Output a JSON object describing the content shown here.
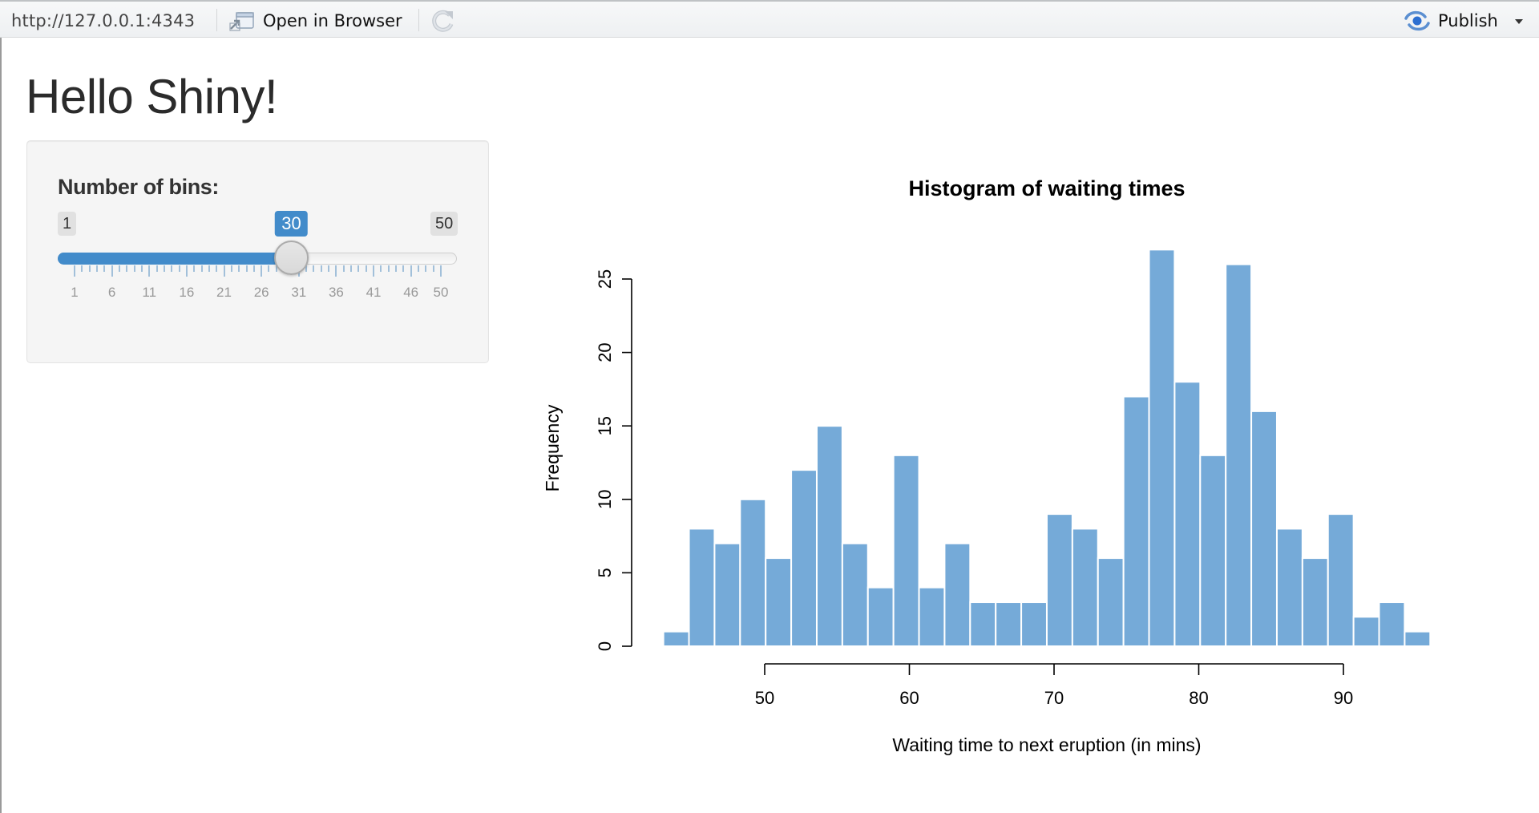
{
  "toolbar": {
    "url": "http://127.0.0.1:4343",
    "open_in_browser_label": "Open in Browser",
    "publish_label": "Publish",
    "icons": {
      "open_in_browser": "open-in-browser-icon",
      "refresh": "refresh-icon",
      "publish": "publish-icon",
      "publish_menu": "caret-down-icon"
    }
  },
  "page": {
    "title": "Hello Shiny!"
  },
  "sidebar": {
    "slider": {
      "label": "Number of bins:",
      "min": 1,
      "max": 50,
      "value": 30,
      "min_label": "1",
      "max_label": "50",
      "value_label": "30",
      "tick_labels": [
        "1",
        "6",
        "11",
        "16",
        "21",
        "26",
        "31",
        "36",
        "41",
        "46",
        "50"
      ],
      "accent_color": "#428bca"
    }
  },
  "chart_data": {
    "type": "bar",
    "subtype": "histogram",
    "title": "Histogram of waiting times",
    "xlabel": "Waiting time to next eruption (in mins)",
    "ylabel": "Frequency",
    "bin_start": 43,
    "bin_end": 96,
    "bin_count": 30,
    "values": [
      1,
      8,
      7,
      10,
      6,
      12,
      15,
      7,
      4,
      13,
      4,
      7,
      3,
      3,
      3,
      9,
      8,
      6,
      17,
      27,
      18,
      13,
      26,
      16,
      8,
      6,
      9,
      2,
      3,
      1
    ],
    "xticks": [
      50,
      60,
      70,
      80,
      90
    ],
    "xtick_labels": [
      "50",
      "60",
      "70",
      "80",
      "90"
    ],
    "yticks": [
      0,
      5,
      10,
      15,
      20,
      25
    ],
    "ytick_labels": [
      "0",
      "5",
      "10",
      "15",
      "20",
      "25"
    ],
    "xlim": [
      43,
      96
    ],
    "ylim": [
      0,
      27
    ],
    "grid": false,
    "legend": "none",
    "bar_color": "#75aad8",
    "border_color": "#ffffff"
  }
}
